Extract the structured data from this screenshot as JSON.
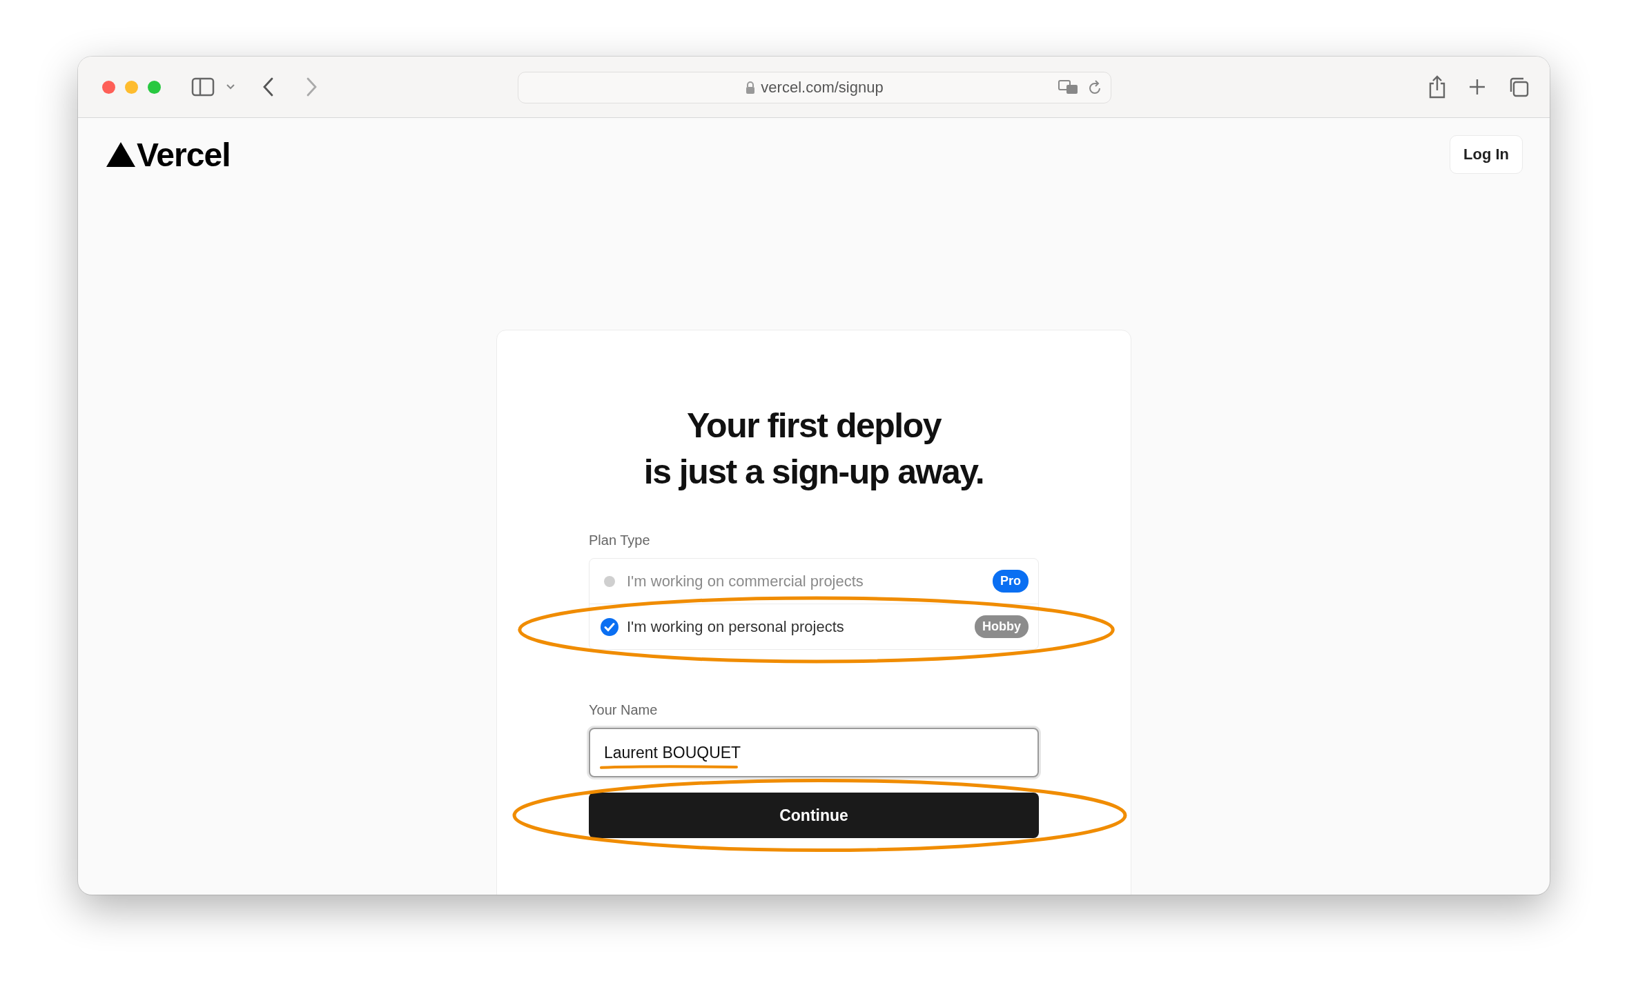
{
  "browser": {
    "address": "vercel.com/signup"
  },
  "header": {
    "logo": "Vercel",
    "login_button": "Log In"
  },
  "signup": {
    "heading_lines": [
      "Your first deploy",
      "is just a sign-up away."
    ],
    "plan_label": "Plan Type",
    "plans": [
      {
        "label": "I'm working on commercial projects",
        "badge": "Pro",
        "color": "#0a6ff2",
        "selected": false
      },
      {
        "label": "I'm working on personal projects",
        "badge": "Hobby",
        "color": "#8c8c8c",
        "selected": true,
        "circled": true
      }
    ],
    "name_label": "Your Name",
    "name_field": {
      "value": "Laurent BOUQUET",
      "underlined": true
    },
    "continue_button": {
      "label": "Continue",
      "circled": true
    }
  }
}
